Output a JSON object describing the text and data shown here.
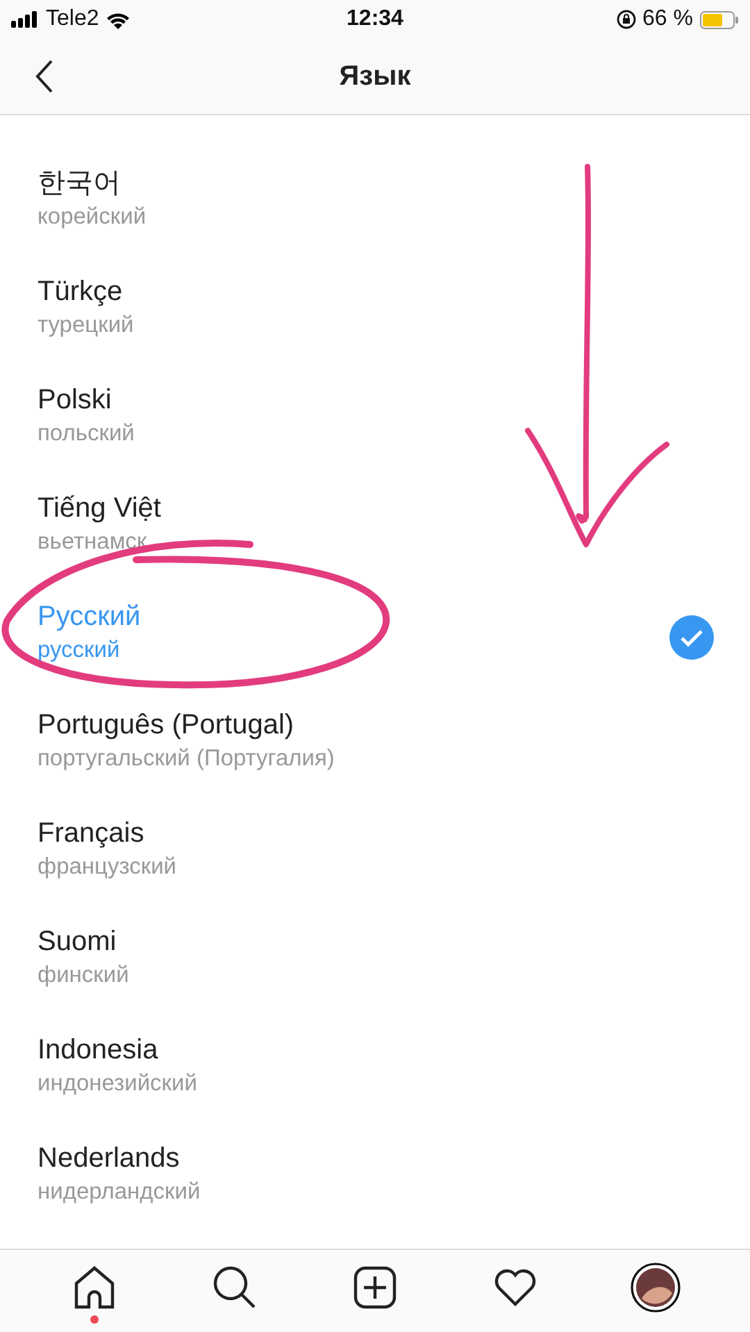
{
  "status_bar": {
    "carrier": "Tele2",
    "time": "12:34",
    "battery": "66 %"
  },
  "nav": {
    "title": "Язык"
  },
  "languages": [
    {
      "name": "한국어",
      "subtitle": "корейский",
      "selected": false
    },
    {
      "name": "Türkçe",
      "subtitle": "турецкий",
      "selected": false
    },
    {
      "name": "Polski",
      "subtitle": "польский",
      "selected": false
    },
    {
      "name": "Tiếng Việt",
      "subtitle": "вьетнамск",
      "selected": false
    },
    {
      "name": "Русский",
      "subtitle": "русский",
      "selected": true
    },
    {
      "name": "Português (Portugal)",
      "subtitle": "португальский (Португалия)",
      "selected": false
    },
    {
      "name": "Français",
      "subtitle": "французский",
      "selected": false
    },
    {
      "name": "Suomi",
      "subtitle": "финский",
      "selected": false
    },
    {
      "name": "Indonesia",
      "subtitle": "индонезийский",
      "selected": false
    },
    {
      "name": "Nederlands",
      "subtitle": "нидерландский",
      "selected": false
    }
  ],
  "tab_bar": [
    {
      "kind": "home",
      "notification": true
    },
    {
      "kind": "search",
      "notification": false
    },
    {
      "kind": "add",
      "notification": false
    },
    {
      "kind": "activity",
      "notification": false
    },
    {
      "kind": "profile",
      "notification": false
    }
  ]
}
